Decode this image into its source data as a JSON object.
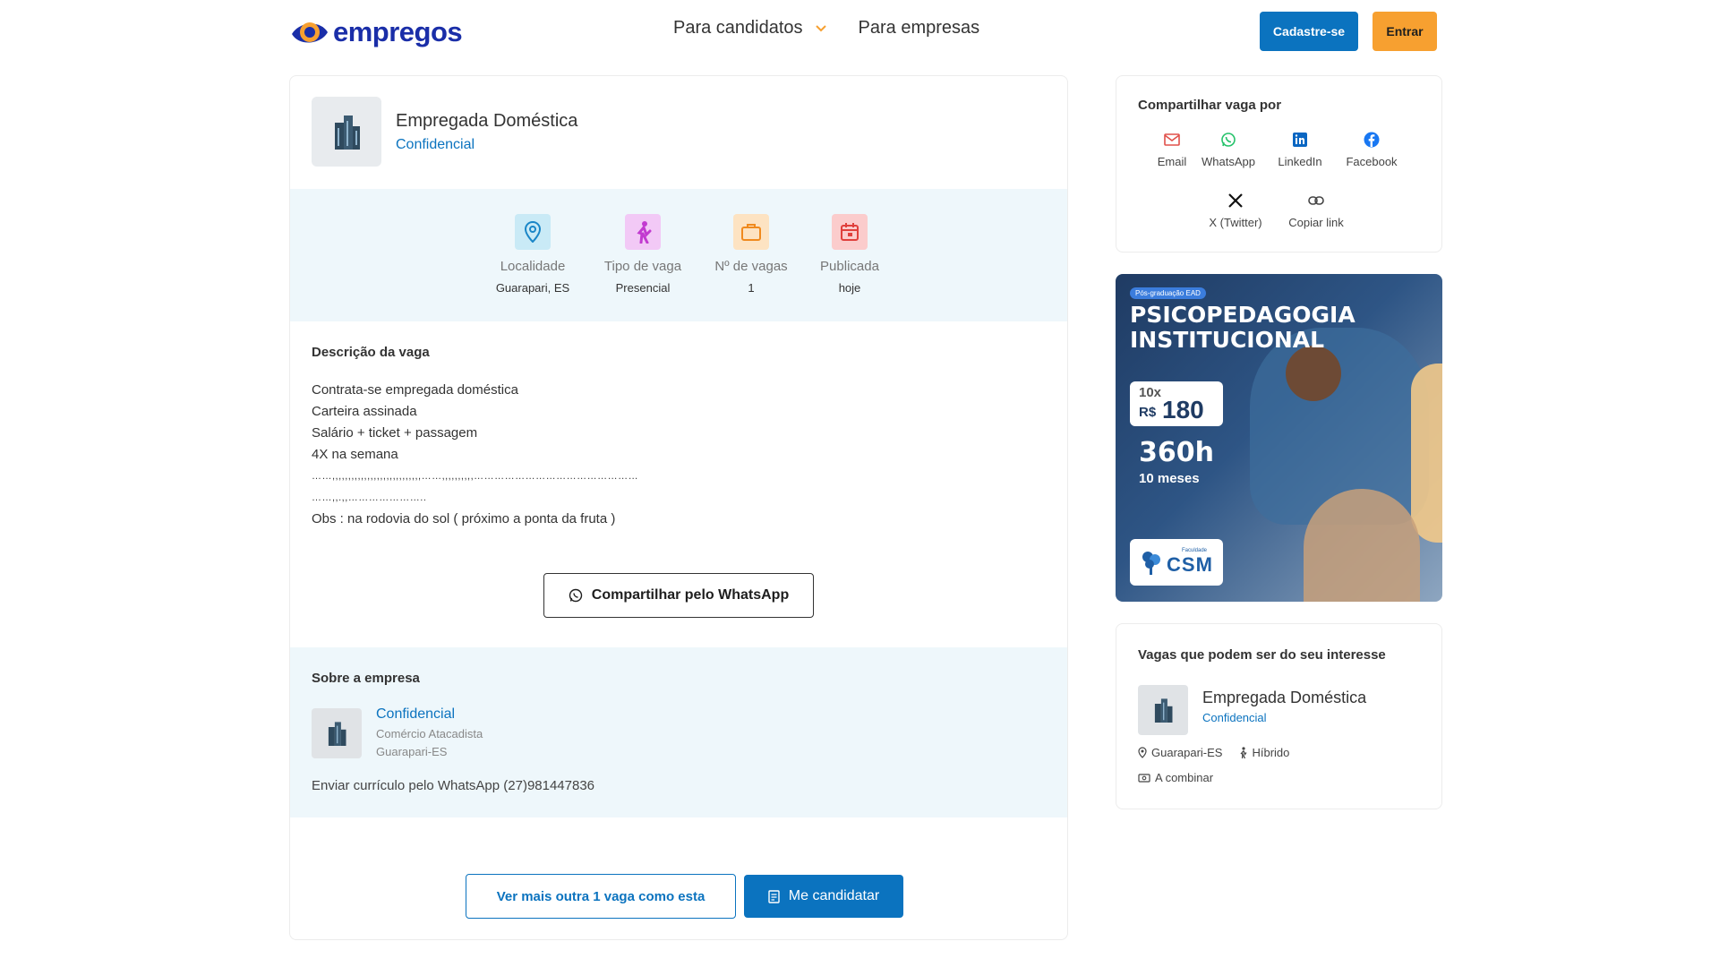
{
  "header": {
    "logo_text": "empregos",
    "nav": [
      {
        "label": "Para candidatos",
        "has_dropdown": true
      },
      {
        "label": "Para empresas",
        "has_dropdown": false
      }
    ],
    "signup_label": "Cadastre-se",
    "login_label": "Entrar"
  },
  "job": {
    "title": "Empregada Doméstica",
    "company": "Confidencial",
    "info": [
      {
        "label": "Localidade",
        "value": "Guarapari, ES",
        "icon": "location-pin-icon",
        "color": "#bfe6f5"
      },
      {
        "label": "Tipo de vaga",
        "value": "Presencial",
        "icon": "person-walking-icon",
        "color": "#f3c6f5"
      },
      {
        "label": "Nº de vagas",
        "value": "1",
        "icon": "briefcase-icon",
        "color": "#fde4c4"
      },
      {
        "label": "Publicada",
        "value": "hoje",
        "icon": "calendar-icon",
        "color": "#fbd0d0"
      }
    ],
    "description_title": "Descrição da vaga",
    "description_lines": [
      "Contrata-se empregada doméstica",
      "Carteira assinada",
      "Salário + ticket + passagem",
      "4X na semana",
      "……,,,,,,,,,,,,,,,,,,,,,,,,,,,,……,,,,,,,,,,…………………………………………",
      "……,,.,,…………………..",
      "Obs : na rodovia do sol ( próximo a ponta da fruta )"
    ],
    "share_whatsapp_label": "Compartilhar pelo WhatsApp"
  },
  "about": {
    "title": "Sobre a empresa",
    "name": "Confidencial",
    "sector": "Comércio Atacadista",
    "city": "Guarapari-ES",
    "note": "Enviar currículo pelo WhatsApp (27)981447836"
  },
  "actions": {
    "more_label": "Ver mais outra 1 vaga como esta",
    "apply_label": "Me candidatar"
  },
  "share": {
    "title": "Compartilhar vaga por",
    "options": [
      {
        "label": "Email",
        "icon": "mail-icon",
        "color": "#e0504a"
      },
      {
        "label": "WhatsApp",
        "icon": "whatsapp-icon",
        "color": "#25c26a"
      },
      {
        "label": "LinkedIn",
        "icon": "linkedin-icon",
        "color": "#0a66c2"
      },
      {
        "label": "Facebook",
        "icon": "facebook-icon",
        "color": "#1877f2"
      },
      {
        "label": "X (Twitter)",
        "icon": "x-icon",
        "color": "#111111"
      },
      {
        "label": "Copiar link",
        "icon": "link-icon",
        "color": "#444444"
      }
    ]
  },
  "ad": {
    "tag": "Pós-graduação EAD",
    "title": "PSICOPEDAGOGIA INSTITUCIONAL",
    "installments": "10x",
    "currency": "R$",
    "price": "180",
    "hours": "360h",
    "duration": "10 meses",
    "brand_small": "Faculdade",
    "brand": "CSM"
  },
  "related": {
    "title": "Vagas que podem ser do seu interesse",
    "job_title": "Empregada Doméstica",
    "company": "Confidencial",
    "location": "Guarapari-ES",
    "mode": "Híbrido",
    "salary": "A combinar"
  }
}
